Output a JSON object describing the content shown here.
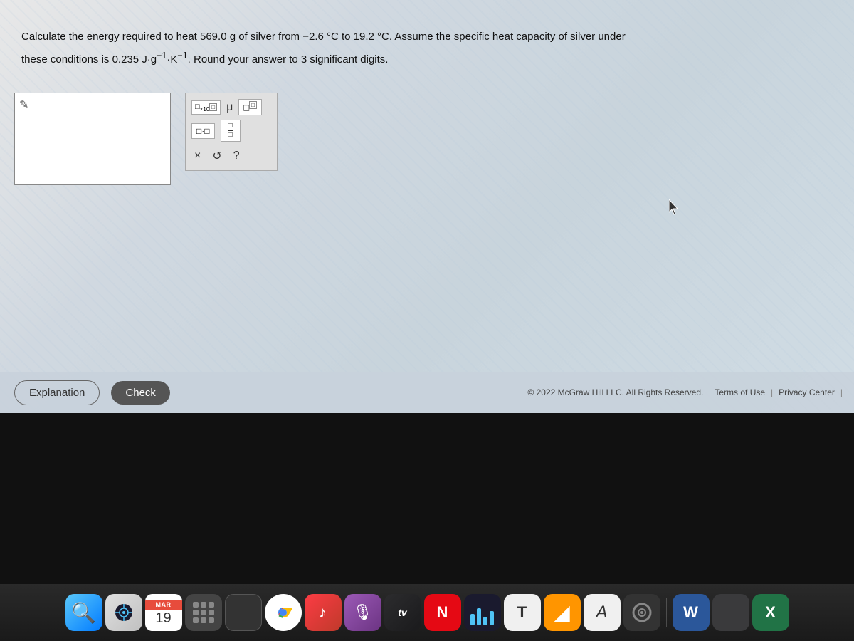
{
  "page": {
    "question_line1": "Calculate the energy required to heat 569.0 g of silver from −2.6 °C to 19.2 °C. Assume the specific heat capacity of silver under",
    "question_line2": "these conditions is 0.235 J·g⁻¹·K⁻¹. Round your answer to 3 significant digits.",
    "footer": {
      "copyright": "© 2022 McGraw Hill LLC. All Rights Reserved.",
      "terms_label": "Terms of Use",
      "separator": "|",
      "privacy_label": "Privacy Center",
      "separator2": "|"
    },
    "buttons": {
      "explanation": "Explanation",
      "check": "Check"
    },
    "toolbar": {
      "x10": "×10",
      "mu": "μ",
      "multiply_dot": "·",
      "fraction": "/",
      "close": "×",
      "undo": "↺",
      "help": "?"
    },
    "dock": {
      "calendar_month": "MAR",
      "calendar_day": "19",
      "tv_label": "tv",
      "netflix_label": "N"
    }
  }
}
